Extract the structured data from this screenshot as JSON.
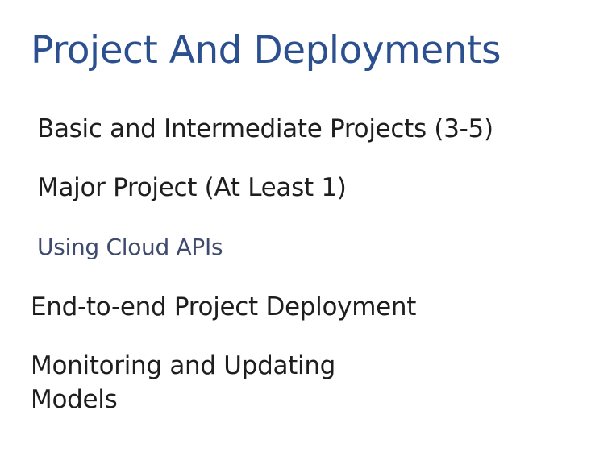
{
  "slide": {
    "title": "Project And Deployments",
    "items": [
      "Basic and Intermediate Projects (3-5)",
      "Major Project (At Least 1)",
      "Using Cloud APIs",
      "End-to-end Project Deployment",
      "Monitoring and Updating Models"
    ]
  },
  "colors": {
    "title": "#2b4f8f",
    "text": "#1e1e1e",
    "highlighted_item": "#3f4b6e",
    "background": "#ffffff"
  }
}
